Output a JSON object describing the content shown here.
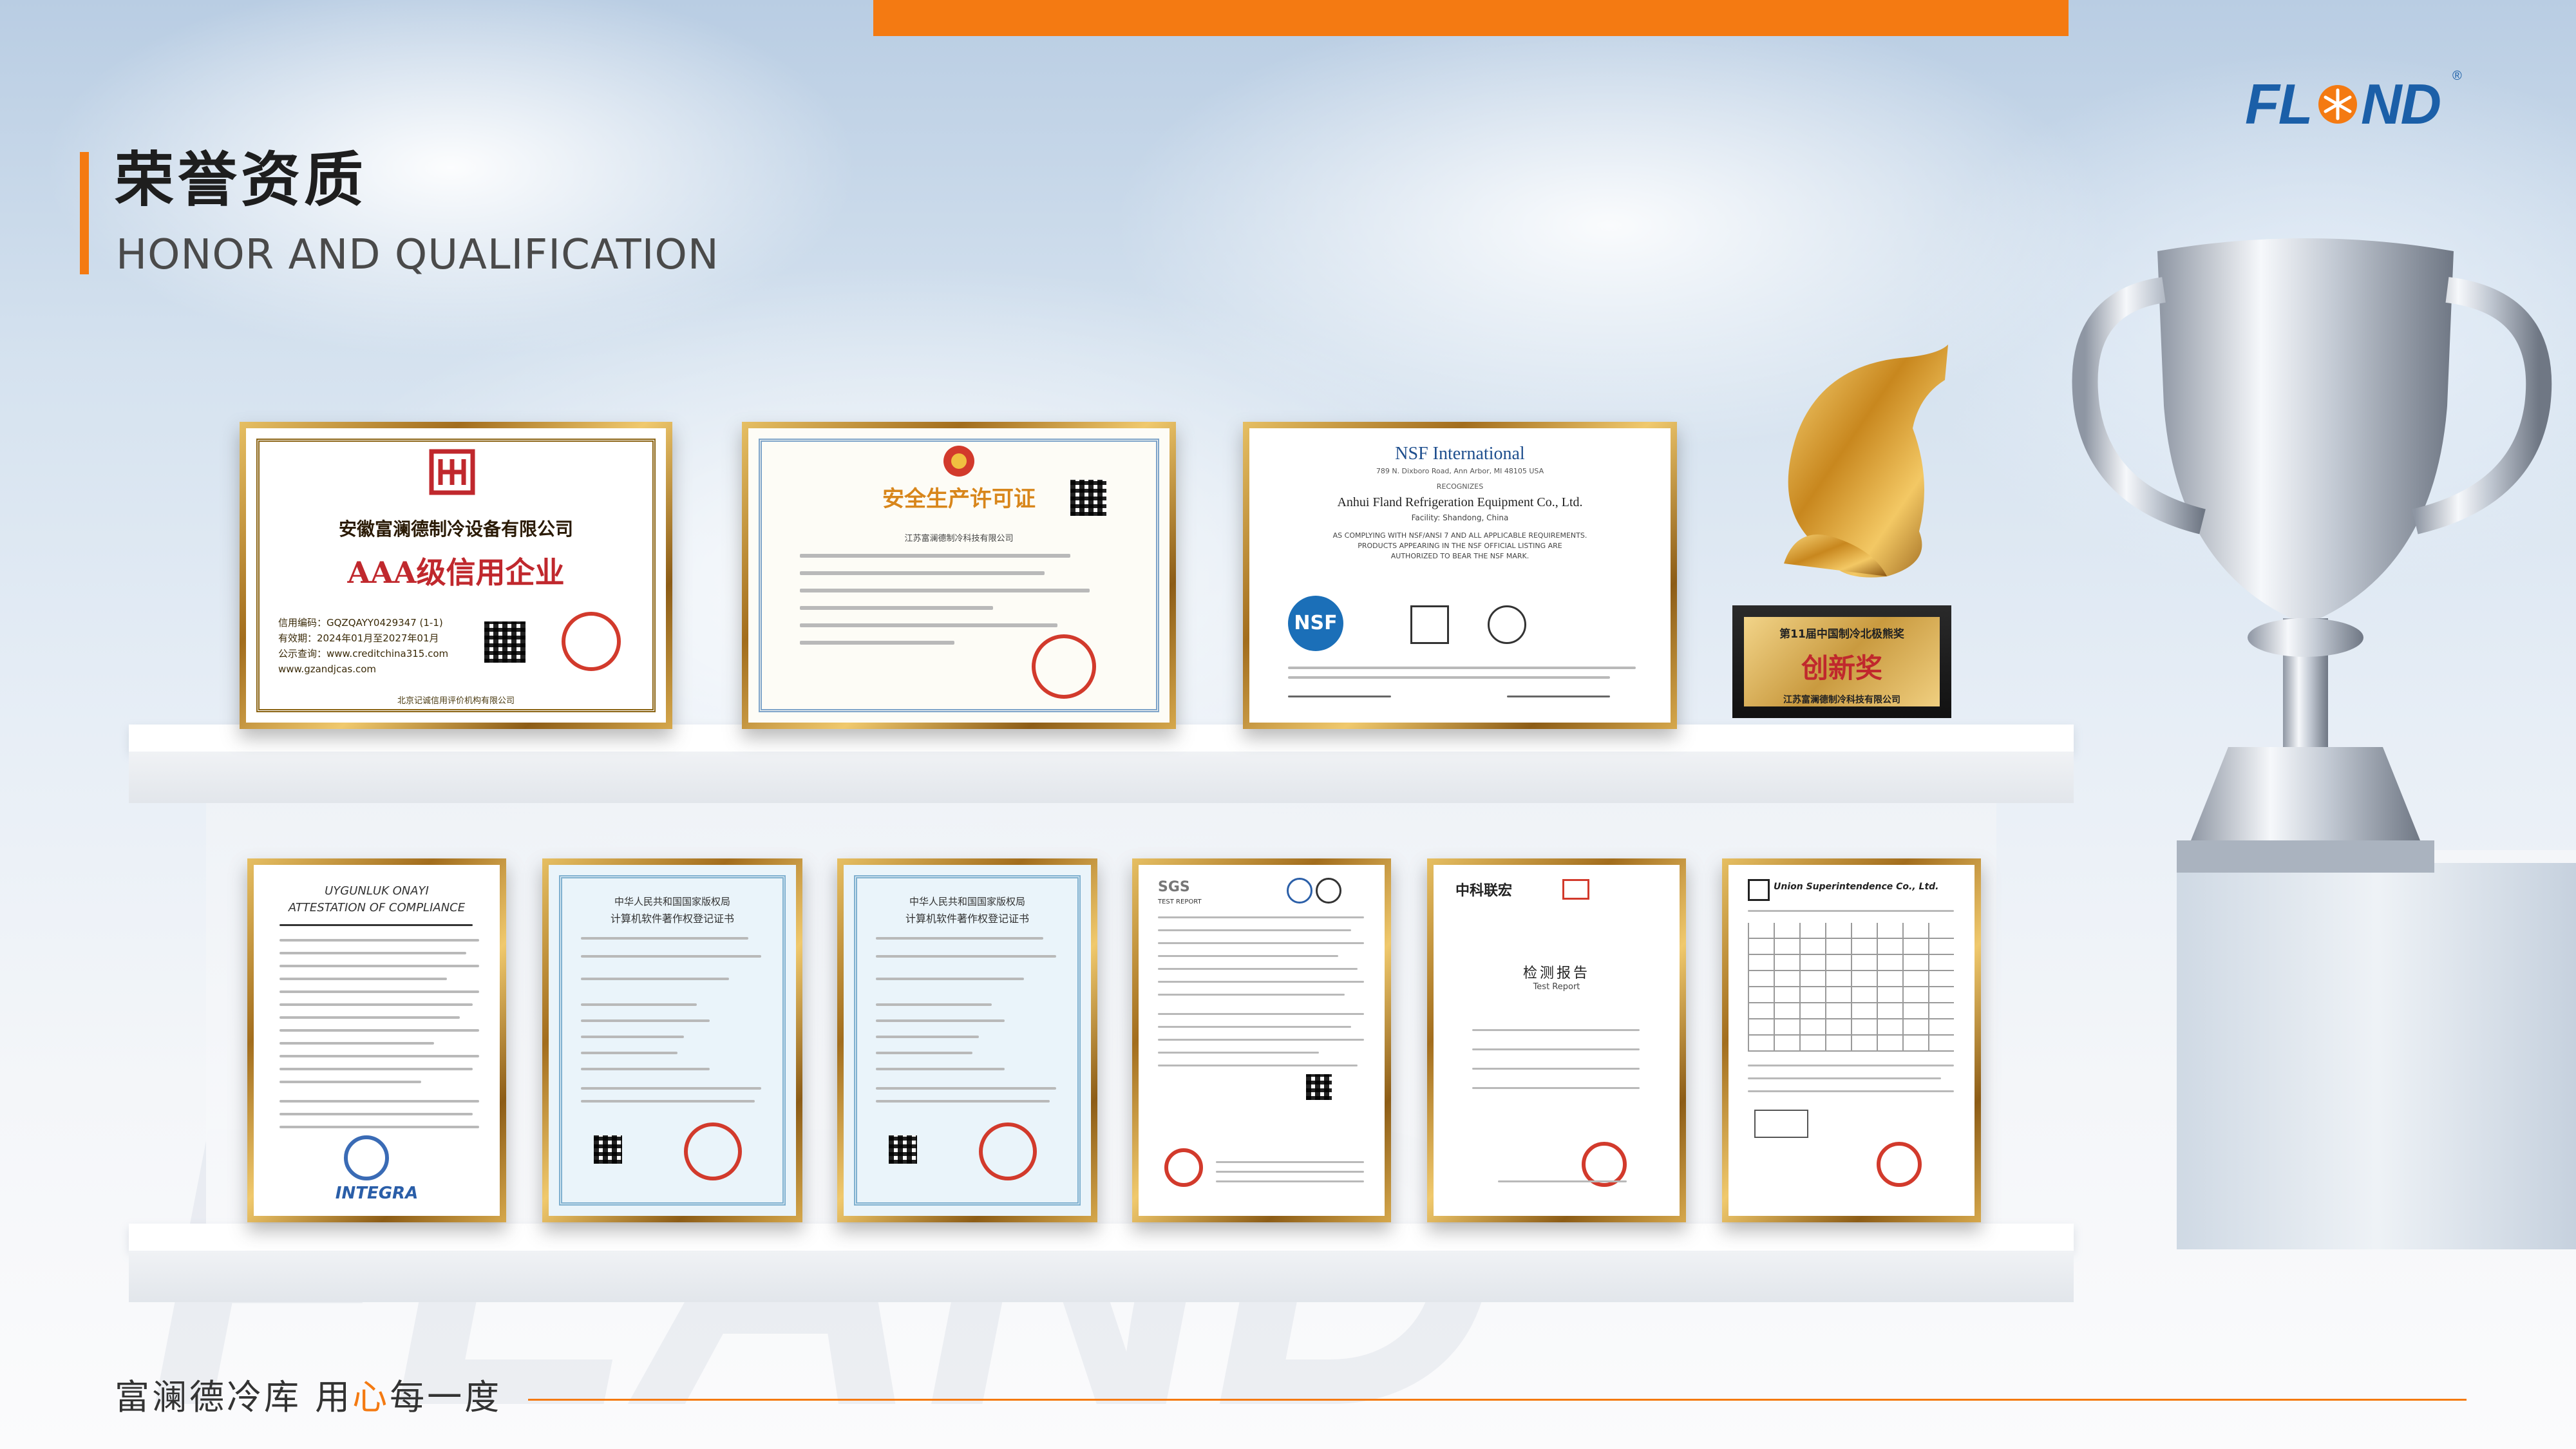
{
  "header": {
    "title_cn": "荣誉资质",
    "title_en": "HONOR AND QUALIFICATION"
  },
  "logo": {
    "text": "FLAND",
    "mark": "®"
  },
  "colors": {
    "accent": "#f47a12",
    "brand_blue": "#1b5fa8",
    "gold": "#d2a94a",
    "seal_red": "#d23a2c"
  },
  "certificates_top": [
    {
      "company": "安徽富澜德制冷设备有限公司",
      "title": "AAA级信用企业",
      "line1": "信用编码：GQZQAYY0429347 (1-1)",
      "line2": "有效期：2024年01月至2027年01月",
      "line3": "公示查询：www.creditchina315.com",
      "line4": "www.gzandjcas.com",
      "footer": "北京记诚信用评价机构有限公司"
    },
    {
      "title": "安全生产许可证",
      "company": "江苏富澜德制冷科技有限公司"
    },
    {
      "org": "NSF International",
      "address": "789 N. Dixboro Road, Ann Arbor, MI 48105 USA",
      "recognizes": "RECOGNIZES",
      "company": "Anhui Fland Refrigeration Equipment Co., Ltd.",
      "facility": "Facility: Shandong, China",
      "body1": "AS COMPLYING WITH NSF/ANSI 7 AND ALL APPLICABLE REQUIREMENTS.",
      "body2": "PRODUCTS APPEARING IN THE NSF OFFICIAL LISTING ARE",
      "body3": "AUTHORIZED TO BEAR THE NSF MARK.",
      "badge": "NSF"
    }
  ],
  "award": {
    "top": "第11届中国制冷北极熊奖",
    "main": "创新奖",
    "company": "江苏富澜德制冷科技有限公司"
  },
  "certificates_bottom": [
    {
      "title": "UYGUNLUK ONAYI",
      "subtitle": "ATTESTATION OF COMPLIANCE",
      "brand": "INTEGRA"
    },
    {
      "title": "中华人民共和国国家版权局",
      "subtitle": "计算机软件著作权登记证书"
    },
    {
      "title": "中华人民共和国国家版权局",
      "subtitle": "计算机软件著作权登记证书"
    },
    {
      "title": "SGS",
      "subtitle": "TEST REPORT"
    },
    {
      "title": "中科联宏",
      "subtitle": "检测报告",
      "subtitle_en": "Test Report"
    },
    {
      "title": "Union Superintendence Co., Ltd."
    }
  ],
  "footer": {
    "text_a": "富澜德冷库  用",
    "text_hl": "心",
    "text_b": "每一度"
  }
}
